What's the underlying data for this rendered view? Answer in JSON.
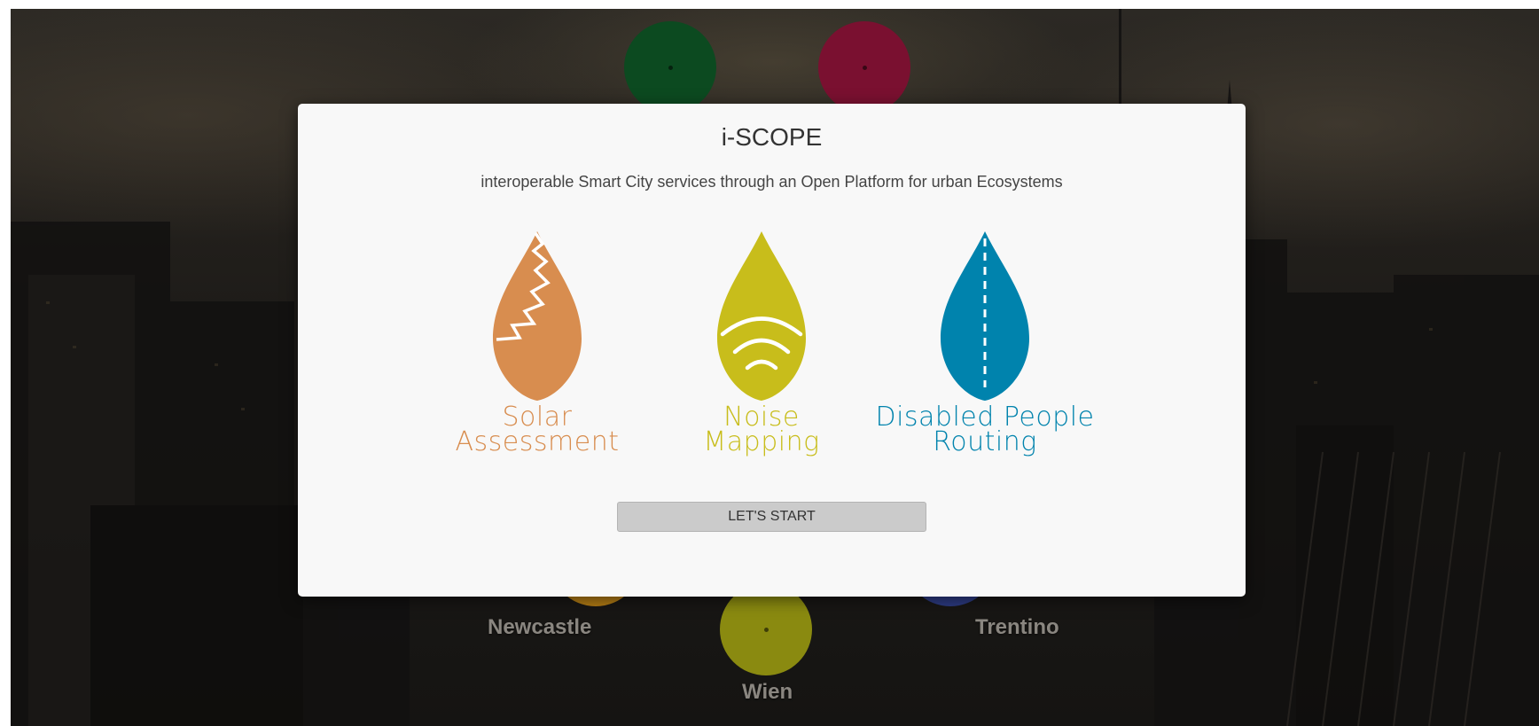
{
  "modal": {
    "title": "i-SCOPE",
    "subtitle": "interoperable Smart City services through an Open Platform for urban Ecosystems",
    "services": [
      {
        "line1": "Solar",
        "line2": "Assessment",
        "icon": "solar-drop-icon",
        "color": "#d88d4f"
      },
      {
        "line1": "Noise",
        "line2": "Mapping",
        "icon": "noise-drop-icon",
        "color": "#c8bd1b"
      },
      {
        "line1": "Disabled People",
        "line2": "Routing",
        "icon": "routing-drop-icon",
        "color": "#0083ad"
      }
    ],
    "start_button": "LET'S START"
  },
  "background": {
    "cities": [
      {
        "name": "Newcastle",
        "color": "#b07a14"
      },
      {
        "name": "Wien",
        "color": "#8a8a10"
      },
      {
        "name": "Trentino",
        "color": "#2c3a80"
      }
    ],
    "top_markers": [
      {
        "color": "#0c4a20"
      },
      {
        "color": "#7a1030"
      }
    ]
  }
}
